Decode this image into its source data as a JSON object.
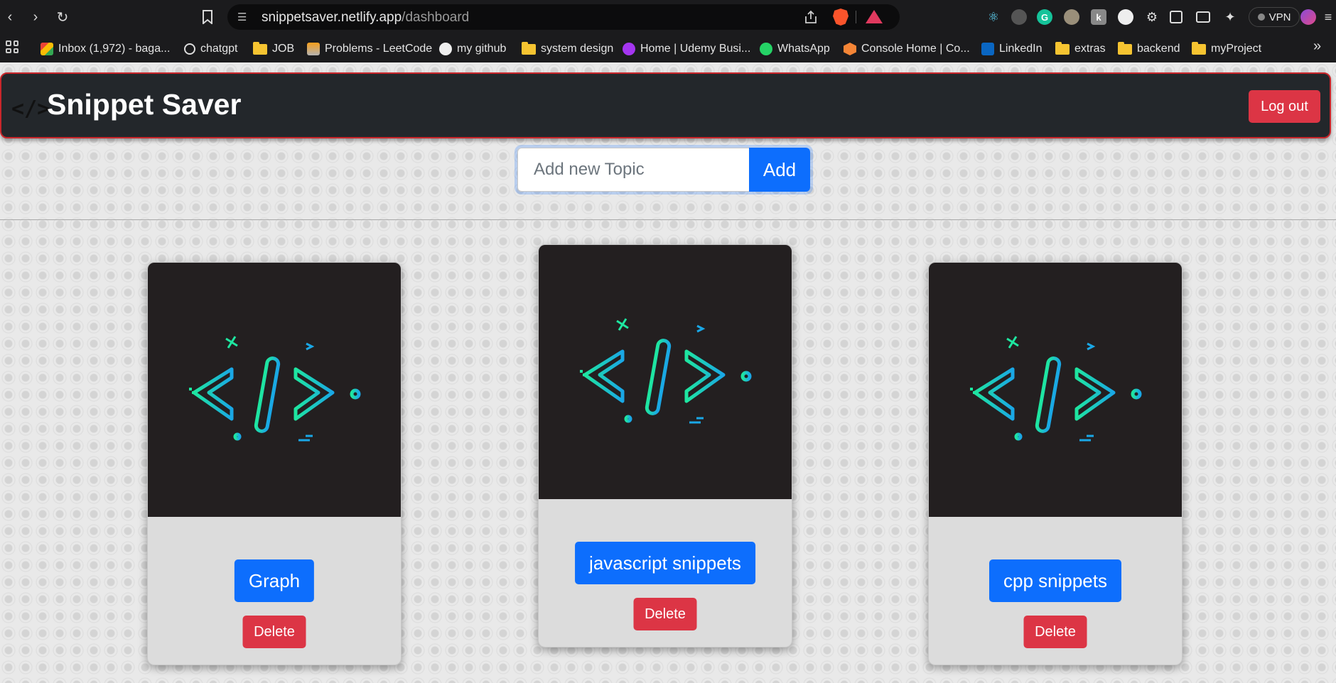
{
  "browser": {
    "url_host": "snippetsaver.netlify.app",
    "url_path": "/dashboard",
    "vpn_label": "VPN",
    "bookmarks": [
      {
        "label": "Inbox (1,972) - baga...",
        "icon": "gmail-icon"
      },
      {
        "label": "chatgpt",
        "icon": "chatgpt-icon"
      },
      {
        "label": "JOB",
        "icon": "folder-icon"
      },
      {
        "label": "Problems - LeetCode",
        "icon": "leetcode-icon"
      },
      {
        "label": "my github",
        "icon": "github-icon"
      },
      {
        "label": "system design",
        "icon": "folder-icon"
      },
      {
        "label": "Home | Udemy Busi...",
        "icon": "udemy-icon"
      },
      {
        "label": "WhatsApp",
        "icon": "whatsapp-icon"
      },
      {
        "label": "Console Home | Co...",
        "icon": "aws-icon"
      },
      {
        "label": "LinkedIn",
        "icon": "linkedin-icon"
      },
      {
        "label": "extras",
        "icon": "folder-icon"
      },
      {
        "label": "backend",
        "icon": "folder-icon"
      },
      {
        "label": "myProject",
        "icon": "folder-icon"
      }
    ]
  },
  "app": {
    "brand_icon": "</>",
    "title": "Snippet Saver",
    "logout_label": "Log out",
    "add_placeholder": "Add new Topic",
    "add_label": "Add"
  },
  "topics": [
    {
      "name": "Graph",
      "delete_label": "Delete"
    },
    {
      "name": "javascript snippets",
      "delete_label": "Delete"
    },
    {
      "name": "cpp snippets",
      "delete_label": "Delete"
    }
  ],
  "colors": {
    "primary": "#0d6efd",
    "danger": "#dc3545",
    "navbar": "#23272b",
    "navbar_border": "#c9262b",
    "card_image_bg": "#231f20",
    "code_green": "#1ee6a0",
    "code_blue": "#1aa7e6"
  }
}
